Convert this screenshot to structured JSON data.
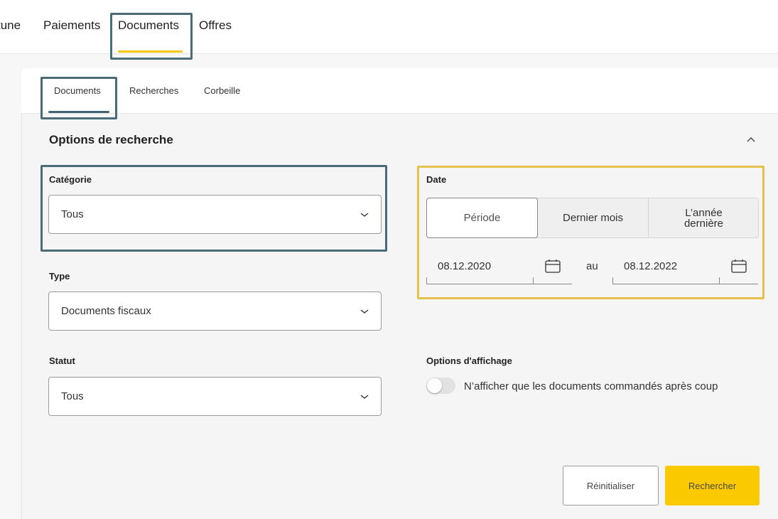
{
  "topnav": {
    "items": [
      {
        "label": "tune"
      },
      {
        "label": "Paiements"
      },
      {
        "label": "Documents"
      },
      {
        "label": "Offres"
      }
    ],
    "active": "Documents",
    "accent_color": "#f2c700"
  },
  "subtabs": {
    "items": [
      {
        "label": "Documents"
      },
      {
        "label": "Recherches"
      },
      {
        "label": "Corbeille"
      }
    ],
    "active": "Documents",
    "accent_color": "#3f6572"
  },
  "search": {
    "title": "Options de recherche",
    "category": {
      "label": "Catégorie",
      "value": "Tous"
    },
    "type": {
      "label": "Type",
      "value": "Documents fiscaux"
    },
    "status": {
      "label": "Statut",
      "value": "Tous"
    },
    "date": {
      "label": "Date",
      "options": [
        "Période",
        "Dernier mois",
        "L’année dernière"
      ],
      "option_annee_line1": "L’année",
      "option_annee_line2": "dernière",
      "selected": "Période",
      "from": "08.12.2020",
      "separator": "au",
      "to": "08.12.2022"
    },
    "display_options": {
      "label": "Options d'affichage",
      "toggle_label": "N’afficher que les documents commandés après coup",
      "toggle_on": false
    },
    "buttons": {
      "reset": "Réinitialiser",
      "search": "Rechercher"
    }
  },
  "colors": {
    "highlight_dark": "#4a6b78",
    "highlight_yellow": "#e6c04a",
    "primary_button": "#fbc900"
  }
}
